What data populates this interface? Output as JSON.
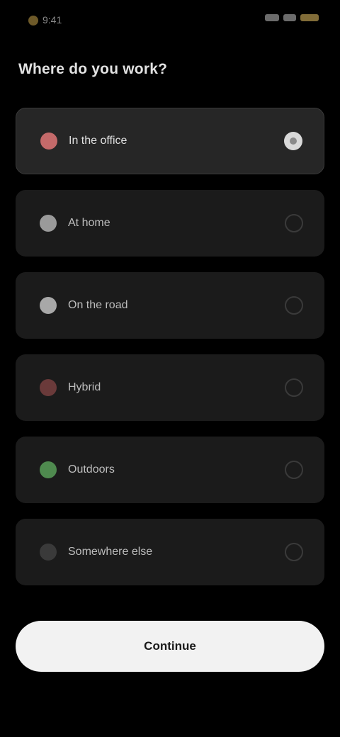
{
  "status_bar": {
    "time": "9:41"
  },
  "title": "Where do you work?",
  "options": [
    {
      "label": "In the office",
      "icon": "building-icon",
      "color": "#c46a6a",
      "selected": true
    },
    {
      "label": "At home",
      "icon": "home-icon",
      "color": "#9a9a9a",
      "selected": false
    },
    {
      "label": "On the road",
      "icon": "car-icon",
      "color": "#a8a8a8",
      "selected": false
    },
    {
      "label": "Hybrid",
      "icon": "mix-icon",
      "color": "#6a3a3a",
      "selected": false
    },
    {
      "label": "Outdoors",
      "icon": "tree-icon",
      "color": "#4f8a4f",
      "selected": false
    },
    {
      "label": "Somewhere else",
      "icon": "dots-icon",
      "color": "#3a3a3a",
      "selected": false
    }
  ],
  "continue_label": "Continue"
}
